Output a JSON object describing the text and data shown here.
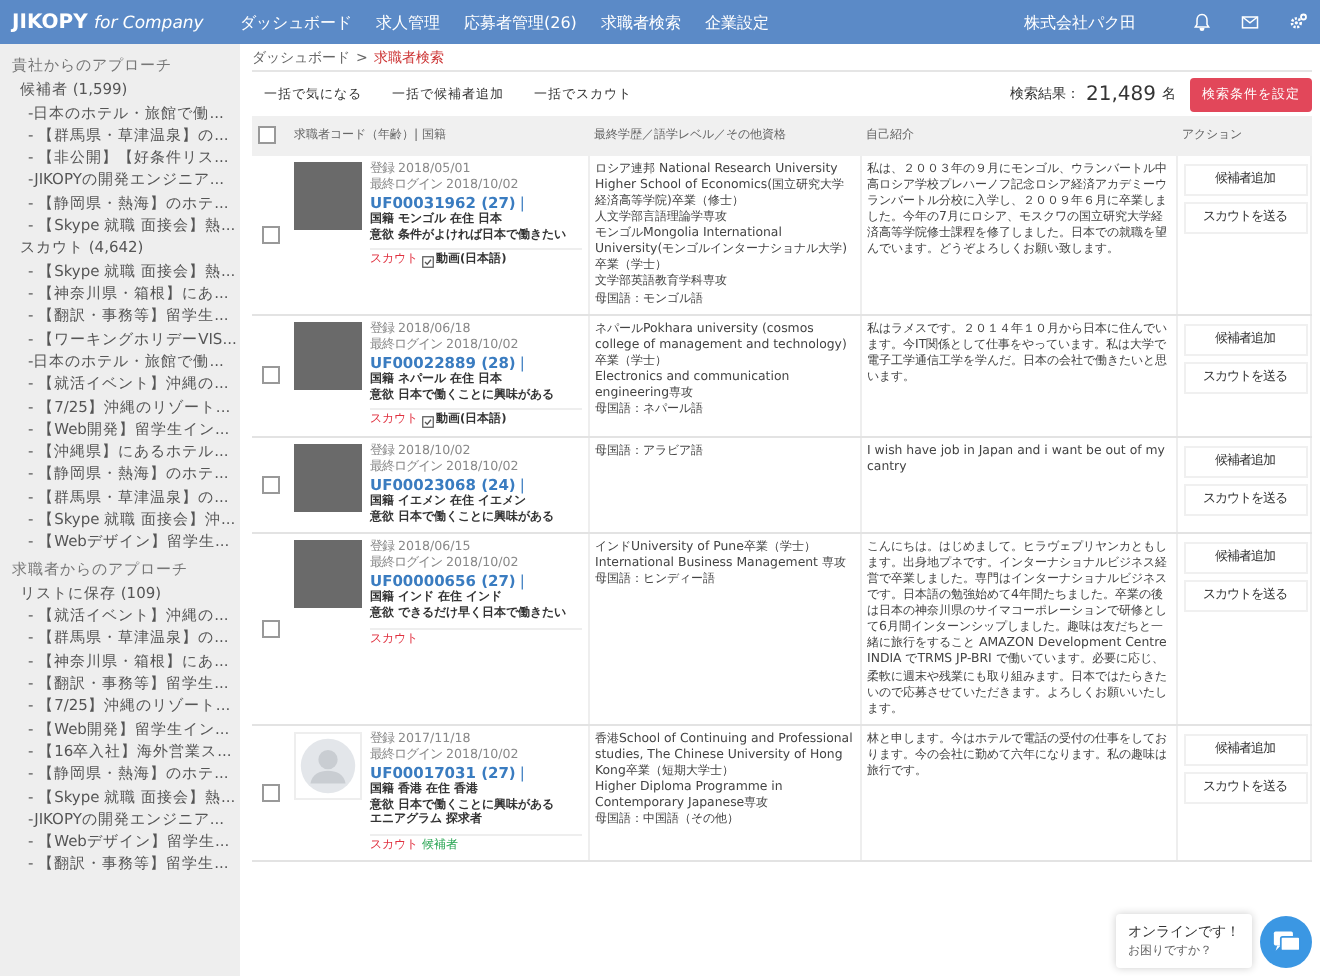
{
  "topbar": {
    "logo": "JIKOPY",
    "logo_suffix": "for Company",
    "nav": [
      "ダッシュボード",
      "求人管理",
      "応募者管理(26)",
      "求職者検索",
      "企業設定"
    ],
    "company": "株式会社パク田"
  },
  "sidebar": {
    "sections": [
      {
        "title": "貴社からのアプローチ",
        "groups": [
          {
            "label": "候補者 (1,599)",
            "items": [
              "-日本のホテル・旅館で働...",
              "- 【群馬県・草津温泉】の...",
              "- 【非公開】【好条件リス...",
              "-JIKOPYの開発エンジニア...",
              "- 【静岡県・熱海】のホテ...",
              "- 【Skype 就職 面接会】熱..."
            ]
          },
          {
            "label": "スカウト (4,642)",
            "items": [
              "- 【Skype 就職 面接会】熱...",
              "- 【神奈川県・箱根】にあ...",
              "- 【翻訳・事務等】留学生...",
              "- 【ワーキングホリデーVIS...",
              "-日本のホテル・旅館で働...",
              "- 【就活イベント】沖縄の...",
              "- 【7/25】沖縄のリゾート...",
              "- 【Web開発】留学生イン...",
              "- 【沖縄県】にあるホテル...",
              "- 【静岡県・熱海】のホテ...",
              "- 【群馬県・草津温泉】の...",
              "- 【Skype 就職 面接会】沖...",
              "- 【Webデザイン】留学生..."
            ]
          }
        ]
      },
      {
        "title": "求職者からのアプローチ",
        "groups": [
          {
            "label": "リストに保存 (109)",
            "items": [
              "- 【就活イベント】沖縄の...",
              "- 【群馬県・草津温泉】の...",
              "- 【神奈川県・箱根】にあ...",
              "- 【翻訳・事務等】留学生...",
              "- 【7/25】沖縄のリゾート...",
              "- 【Web開発】留学生イン...",
              "- 【16卒入社】海外営業ス...",
              "- 【静岡県・熱海】のホテ...",
              "- 【Skype 就職 面接会】熱...",
              "-JIKOPYの開発エンジニア...",
              "- 【Webデザイン】留学生...",
              "- 【翻訳・事務等】留学生..."
            ]
          }
        ]
      }
    ]
  },
  "breadcrumb": {
    "items": [
      "ダッシュボード",
      "求職者検索"
    ],
    "separator": ">"
  },
  "toolbar": {
    "buttons": [
      "一括で気になる",
      "一括で候補者追加",
      "一括でスカウト"
    ],
    "result_label": "検索結果：",
    "result_count": "21,489",
    "result_unit": "名",
    "filter_button": "検索条件を設定"
  },
  "table": {
    "select_all": {
      "checked": false
    },
    "columns": [
      "求職者コード（年齢）| 国籍",
      "最終学歴／語学レベル／その他資格",
      "自己紹介",
      "アクション"
    ],
    "rows": [
      {
        "checked": false,
        "photo": {
          "kind": "photo"
        },
        "registered": "登録 2018/05/01",
        "last_login": "最終ログイン 2018/10/02",
        "code": "UF00031962 (27)",
        "bar": "|",
        "details": [
          "国籍 モンゴル 在住 日本",
          "意欲 条件がよければ日本で働きたい"
        ],
        "tags": [
          {
            "kind": "scout",
            "text": "スカウト"
          },
          {
            "kind": "video",
            "text": "動画(日本語)"
          }
        ],
        "education": [
          "ロシア連邦 National Research University Higher School of Economics(国立研究大学経済高等学院)卒業（修士）",
          "人文学部言語理論学専攻",
          "モンゴルMongolia International University(モンゴルインターナショナル大学)卒業（学士）",
          "文学部英語教育学科専攻",
          "母国語：モンゴル語"
        ],
        "intro": "私は、２００３年の９月にモンゴル、ウランバートル中高ロシア学校プレハーノフ記念ロシア経済アカデミーウランバートル分校に入学し、２００９年６月に卒業しました。今年の7月にロシア、モスクワの国立研究大学経済高等学院修士課程を修了しました。日本での就職を望んでいます。どうぞよろしくお願い致します。",
        "actions": [
          "候補者追加",
          "スカウトを送る"
        ]
      },
      {
        "checked": false,
        "photo": {
          "kind": "photo"
        },
        "registered": "登録 2018/06/18",
        "last_login": "最終ログイン 2018/10/02",
        "code": "UF00022889 (28)",
        "bar": "|",
        "details": [
          "国籍 ネパール 在住 日本",
          "意欲 日本で働くことに興味がある"
        ],
        "tags": [
          {
            "kind": "scout",
            "text": "スカウト"
          },
          {
            "kind": "video",
            "text": "動画(日本語)"
          }
        ],
        "education": [
          "ネパールPokhara university (cosmos college of management and technology)卒業（学士）",
          "Electronics and communication engineering専攻",
          "母国語：ネパール語"
        ],
        "intro": "私はラメスです。２０１４年１０月から日本に住んでいます。今IT関係として仕事をやっています。私は大学で電子工学通信工学を学んだ。日本の会社で働きたいと思います。",
        "actions": [
          "候補者追加",
          "スカウトを送る"
        ]
      },
      {
        "checked": false,
        "photo": {
          "kind": "photo"
        },
        "registered": "登録 2018/10/02",
        "last_login": "最終ログイン 2018/10/02",
        "code": "UF00023068 (24)",
        "bar": "|",
        "details": [
          "国籍 イエメン 在住 イエメン",
          "意欲 日本で働くことに興味がある"
        ],
        "tags": [],
        "education": [
          "母国語：アラビア語"
        ],
        "intro": "I wish have job in Japan and i want be out of my cantry",
        "actions": [
          "候補者追加",
          "スカウトを送る"
        ]
      },
      {
        "checked": false,
        "photo": {
          "kind": "photo"
        },
        "registered": "登録 2018/06/15",
        "last_login": "最終ログイン 2018/10/02",
        "code": "UF00000656 (27)",
        "bar": "|",
        "details": [
          "国籍 インド 在住 インド",
          "意欲 できるだけ早く日本で働きたい"
        ],
        "tags": [
          {
            "kind": "scout",
            "text": "スカウト"
          }
        ],
        "education": [
          "インドUniversity of Pune卒業（学士）",
          "International Business Management 専攻",
          "母国語：ヒンディー語"
        ],
        "intro": "こんにちは。はじめまして。ヒラヴェプリヤンカともします。出身地プネです。インターナショナルビジネス経営で卒業しました。専門はインターナショナルビジネスです。日本語の勉強始めて4年間たちました。卒業の後は日本の神奈川県のサイマコーポレーションで研修として6月間インターンシップしました。趣味は友だちと一緒に旅行をすること AMAZON Development Centre INDIA でTRMS JP-BRI で働いています。必要に応じ、柔軟に週末や残業にも取り組みます。日本ではたらきたいので応募させていただきます。よろしくお願いいたします。",
        "actions": [
          "候補者追加",
          "スカウトを送る"
        ]
      },
      {
        "checked": false,
        "photo": {
          "kind": "avatar"
        },
        "registered": "登録 2017/11/18",
        "last_login": "最終ログイン 2018/10/02",
        "code": "UF00017031 (27)",
        "bar": "|",
        "details": [
          "国籍 香港 在住 香港",
          "意欲 日本で働くことに興味がある",
          "エニアグラム 探求者"
        ],
        "tags": [
          {
            "kind": "scout",
            "text": "スカウト"
          },
          {
            "kind": "candidate",
            "text": "候補者"
          }
        ],
        "education": [
          "香港School of Continuing and Professional studies, The Chinese University of Hong Kong卒業（短期大学士）",
          "Higher Diploma Programme in Contemporary Japanese専攻",
          "母国語：中国語（その他）"
        ],
        "intro": "林と申します。今はホテルで電話の受付の仕事をしております。今の会社に勤めて六年になります。私の趣味は旅行です。",
        "actions": [
          "候補者追加",
          "スカウトを送る"
        ]
      }
    ]
  },
  "chat": {
    "title": "オンラインです！",
    "subtitle": "お困りですか？"
  }
}
